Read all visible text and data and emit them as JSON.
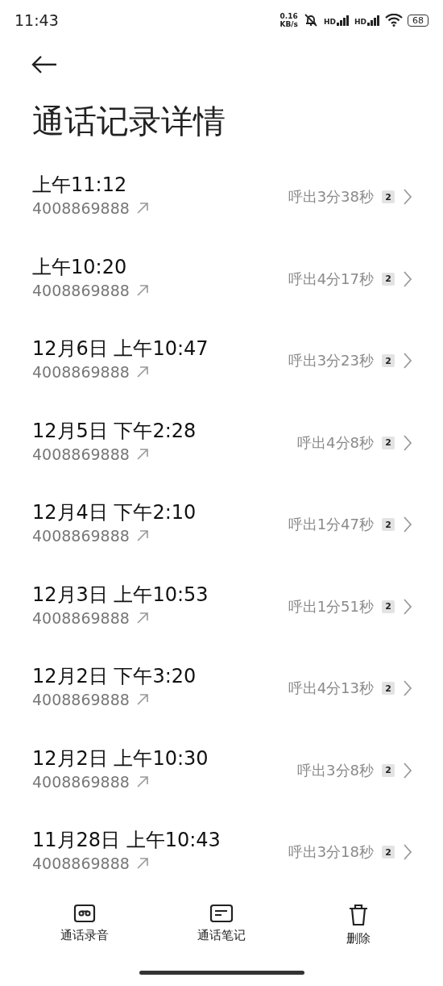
{
  "status_bar": {
    "time": "11:43",
    "speed_value": "0.16",
    "speed_unit": "KB/s",
    "sim_1_label": "HD",
    "sim_2_label": "HD",
    "battery": "68"
  },
  "header": {
    "title": "通话记录详情"
  },
  "calls": [
    {
      "time": "上午11:12",
      "number": "4008869888",
      "summary": "呼出3分38秒",
      "sim": "2"
    },
    {
      "time": "上午10:20",
      "number": "4008869888",
      "summary": "呼出4分17秒",
      "sim": "2"
    },
    {
      "time": "12月6日 上午10:47",
      "number": "4008869888",
      "summary": "呼出3分23秒",
      "sim": "2"
    },
    {
      "time": "12月5日 下午2:28",
      "number": "4008869888",
      "summary": "呼出4分8秒",
      "sim": "2"
    },
    {
      "time": "12月4日 下午2:10",
      "number": "4008869888",
      "summary": "呼出1分47秒",
      "sim": "2"
    },
    {
      "time": "12月3日 上午10:53",
      "number": "4008869888",
      "summary": "呼出1分51秒",
      "sim": "2"
    },
    {
      "time": "12月2日 下午3:20",
      "number": "4008869888",
      "summary": "呼出4分13秒",
      "sim": "2"
    },
    {
      "time": "12月2日 上午10:30",
      "number": "4008869888",
      "summary": "呼出3分8秒",
      "sim": "2"
    },
    {
      "time": "11月28日 上午10:43",
      "number": "4008869888",
      "summary": "呼出3分18秒",
      "sim": "2"
    }
  ],
  "bottom_actions": [
    {
      "kind": "recording",
      "label": "通话录音"
    },
    {
      "kind": "notes",
      "label": "通话笔记"
    },
    {
      "kind": "delete",
      "label": "删除"
    }
  ]
}
